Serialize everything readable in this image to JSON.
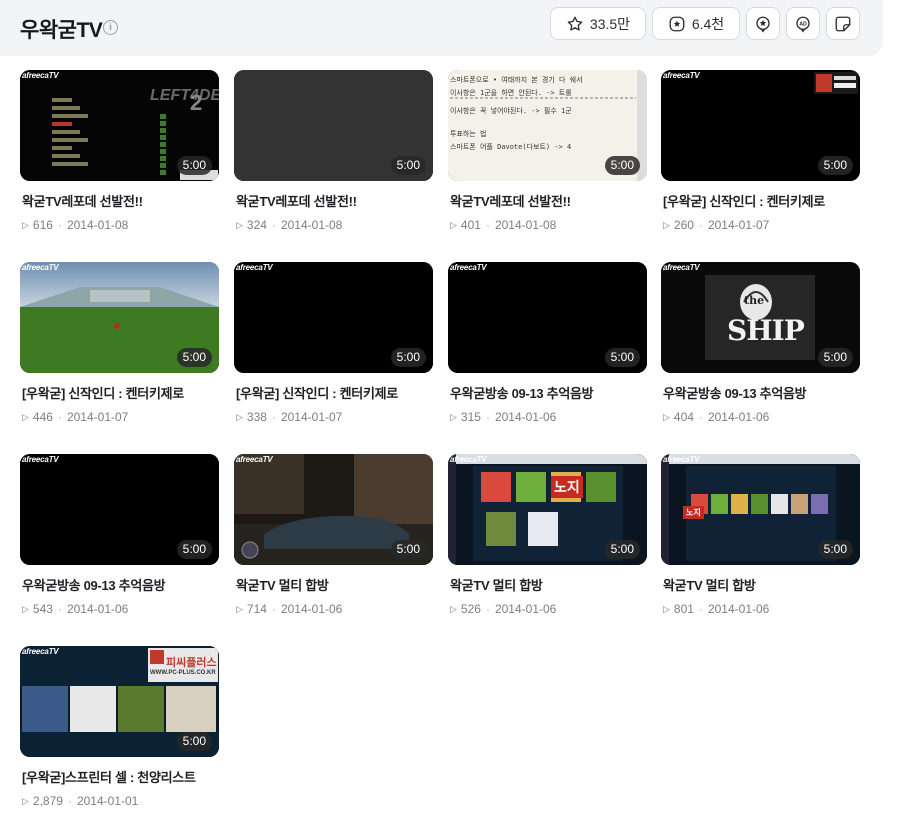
{
  "header": {
    "channel_name": "우왁굳TV",
    "info_icon": "i",
    "favorite_count": "33.5만",
    "subscribe_count": "6.4천"
  },
  "videos": [
    {
      "title": "왁굳TV레포데 선발전!!",
      "views": "616",
      "date": "2014-01-08",
      "duration": "5:00",
      "thumb": "l4d"
    },
    {
      "title": "왁굳TV레포데 선발전!!",
      "views": "324",
      "date": "2014-01-08",
      "duration": "5:00",
      "thumb": "gray"
    },
    {
      "title": "왁굳TV레포데 선발전!!",
      "views": "401",
      "date": "2014-01-08",
      "duration": "5:00",
      "thumb": "notepad",
      "thumb_lines": [
        "스마트폰으로 • 여태까지 본 경기 다 쉐서",
        "이사항은 1군을 하면 안된다. -> 트롤",
        "이사항은 꼭 넣어야된다. -> 필수 1군",
        "투표하는 법",
        "스마트폰 어플 Davote(다보트) -> 4"
      ]
    },
    {
      "title": "[우왁굳] 신작인디 : 켄터키제로",
      "views": "260",
      "date": "2014-01-07",
      "duration": "5:00",
      "thumb": "black_ad"
    },
    {
      "title": "[우왁굳] 신작인디 : 켄터키제로",
      "views": "446",
      "date": "2014-01-07",
      "duration": "5:00",
      "thumb": "stadium"
    },
    {
      "title": "[우왁굳] 신작인디 : 켄터키제로",
      "views": "338",
      "date": "2014-01-07",
      "duration": "5:00",
      "thumb": "black"
    },
    {
      "title": "우왁굳방송 09-13 추억음방",
      "views": "315",
      "date": "2014-01-06",
      "duration": "5:00",
      "thumb": "black"
    },
    {
      "title": "우왁굳방송 09-13 추억음방",
      "views": "404",
      "date": "2014-01-06",
      "duration": "5:00",
      "thumb": "ship",
      "thumb_text_top": "the",
      "thumb_text_main": "SHIP"
    },
    {
      "title": "우왁굳방송 09-13 추억음방",
      "views": "543",
      "date": "2014-01-06",
      "duration": "5:00",
      "thumb": "black"
    },
    {
      "title": "왁굳TV 멀티 합방",
      "views": "714",
      "date": "2014-01-06",
      "duration": "5:00",
      "thumb": "car"
    },
    {
      "title": "왁굳TV 멀티 합방",
      "views": "526",
      "date": "2014-01-06",
      "duration": "5:00",
      "thumb": "multi",
      "thumb_label": "노지"
    },
    {
      "title": "왁굳TV 멀티 합방",
      "views": "801",
      "date": "2014-01-06",
      "duration": "5:00",
      "thumb": "multi2",
      "thumb_label": "노지"
    },
    {
      "title": "[우왁굳]스프린터 셀 : 천양리스트",
      "views": "2,879",
      "date": "2014-01-01",
      "duration": "5:00",
      "thumb": "splinter",
      "thumb_banner": "피씨플러스",
      "thumb_banner_sub": "WWW.PC-PLUS.CO.KR"
    }
  ],
  "thumb_watermark": "afreecaTV",
  "ad_banner": "피씨플러스",
  "colors": {
    "topbar": "#f3f4f6",
    "text_primary": "#1f2024",
    "text_meta": "#7a7e86",
    "duration_bg": "#282828"
  }
}
